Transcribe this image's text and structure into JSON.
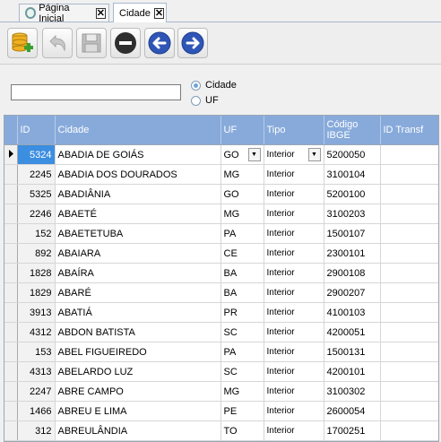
{
  "tabs": [
    {
      "label": "Página Inicial",
      "icon": "gear-icon",
      "close": "✕"
    },
    {
      "label": "Cidade",
      "close": "✕"
    }
  ],
  "toolbar": {
    "buttons": [
      "database-add-icon",
      "undo-icon",
      "save-icon",
      "remove-icon",
      "arrow-left-icon",
      "arrow-right-icon"
    ]
  },
  "filter": {
    "search_value": "",
    "options": [
      {
        "label": "Cidade",
        "selected": true
      },
      {
        "label": "UF",
        "selected": false
      }
    ]
  },
  "grid": {
    "columns": [
      "ID",
      "Cidade",
      "UF",
      "Tipo",
      "Código IBGE",
      "ID Transf"
    ],
    "rows": [
      {
        "id": "5324",
        "cidade": "ABADIA DE GOIÁS",
        "uf": "GO",
        "tipo": "Interior",
        "ibge": "5200050",
        "transf": ""
      },
      {
        "id": "2245",
        "cidade": "ABADIA DOS DOURADOS",
        "uf": "MG",
        "tipo": "Interior",
        "ibge": "3100104",
        "transf": ""
      },
      {
        "id": "5325",
        "cidade": "ABADIÂNIA",
        "uf": "GO",
        "tipo": "Interior",
        "ibge": "5200100",
        "transf": ""
      },
      {
        "id": "2246",
        "cidade": "ABAETÉ",
        "uf": "MG",
        "tipo": "Interior",
        "ibge": "3100203",
        "transf": ""
      },
      {
        "id": "152",
        "cidade": "ABAETETUBA",
        "uf": "PA",
        "tipo": "Interior",
        "ibge": "1500107",
        "transf": ""
      },
      {
        "id": "892",
        "cidade": "ABAIARA",
        "uf": "CE",
        "tipo": "Interior",
        "ibge": "2300101",
        "transf": ""
      },
      {
        "id": "1828",
        "cidade": "ABAÍRA",
        "uf": "BA",
        "tipo": "Interior",
        "ibge": "2900108",
        "transf": ""
      },
      {
        "id": "1829",
        "cidade": "ABARÉ",
        "uf": "BA",
        "tipo": "Interior",
        "ibge": "2900207",
        "transf": ""
      },
      {
        "id": "3913",
        "cidade": "ABATIÁ",
        "uf": "PR",
        "tipo": "Interior",
        "ibge": "4100103",
        "transf": ""
      },
      {
        "id": "4312",
        "cidade": "ABDON BATISTA",
        "uf": "SC",
        "tipo": "Interior",
        "ibge": "4200051",
        "transf": ""
      },
      {
        "id": "153",
        "cidade": "ABEL FIGUEIREDO",
        "uf": "PA",
        "tipo": "Interior",
        "ibge": "1500131",
        "transf": ""
      },
      {
        "id": "4313",
        "cidade": "ABELARDO LUZ",
        "uf": "SC",
        "tipo": "Interior",
        "ibge": "4200101",
        "transf": ""
      },
      {
        "id": "2247",
        "cidade": "ABRE CAMPO",
        "uf": "MG",
        "tipo": "Interior",
        "ibge": "3100302",
        "transf": ""
      },
      {
        "id": "1466",
        "cidade": "ABREU E LIMA",
        "uf": "PE",
        "tipo": "Interior",
        "ibge": "2600054",
        "transf": ""
      },
      {
        "id": "312",
        "cidade": "ABREULÂNDIA",
        "uf": "TO",
        "tipo": "Interior",
        "ibge": "1700251",
        "transf": ""
      }
    ]
  },
  "colors": {
    "header_bg": "#87aadb",
    "selected_cell": "#3c8ee0"
  }
}
